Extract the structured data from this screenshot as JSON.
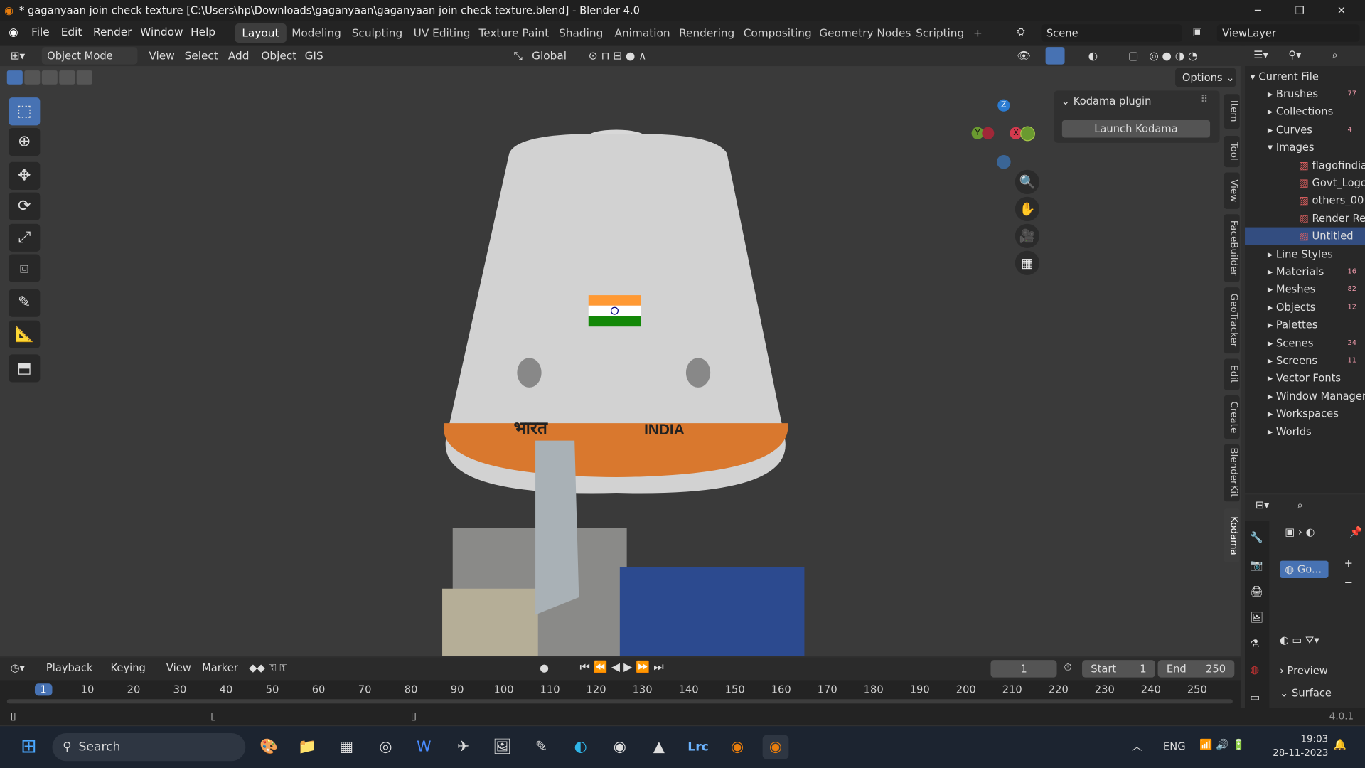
{
  "window": {
    "title": "* gaganyaan join check texture [C:\\Users\\hp\\Downloads\\gaganyaan\\gaganyaan join check texture.blend] - Blender 4.0",
    "minimize": "─",
    "maximize": "❐",
    "close": "✕"
  },
  "menubar": {
    "items": [
      "File",
      "Edit",
      "Render",
      "Window",
      "Help"
    ],
    "workspaces": [
      "Layout",
      "Modeling",
      "Sculpting",
      "UV Editing",
      "Texture Paint",
      "Shading",
      "Animation",
      "Rendering",
      "Compositing",
      "Geometry Nodes",
      "Scripting"
    ],
    "add_workspace": "+",
    "scene": "Scene",
    "view_layer": "ViewLayer"
  },
  "viewport_header": {
    "mode": "Object Mode",
    "menus": [
      "View",
      "Select",
      "Add",
      "Object",
      "GIS"
    ],
    "orientation": "Global",
    "options": "Options"
  },
  "viewport": {
    "plugin_panel_title": "Kodama plugin",
    "launch_button": "Launch Kodama",
    "side_tabs": [
      "Item",
      "Tool",
      "View",
      "FaceBuilder",
      "GeoTracker",
      "Edit",
      "Create",
      "BlenderKit",
      "Kodama"
    ],
    "gizmo": {
      "z": "Z",
      "x": "X",
      "y": "Y"
    },
    "capsule_text_hindi": "भारत",
    "capsule_text_english": "INDIA"
  },
  "outliner": {
    "root": "Current File",
    "items": [
      {
        "label": "Brushes",
        "badge": "77",
        "expanded": false
      },
      {
        "label": "Collections",
        "badge": "",
        "expanded": false
      },
      {
        "label": "Curves",
        "badge": "4",
        "expanded": false
      },
      {
        "label": "Images",
        "badge": "",
        "expanded": true
      },
      {
        "label": "flagofindia",
        "child": true
      },
      {
        "label": "Govt_Logo",
        "child": true
      },
      {
        "label": "others_00",
        "child": true
      },
      {
        "label": "Render Result",
        "child": true
      },
      {
        "label": "Untitled",
        "child": true,
        "selected": true
      },
      {
        "label": "Line Styles",
        "expanded": false
      },
      {
        "label": "Materials",
        "badge": "16",
        "expanded": false
      },
      {
        "label": "Meshes",
        "badge": "82",
        "expanded": false
      },
      {
        "label": "Objects",
        "badge": "12",
        "expanded": false
      },
      {
        "label": "Palettes",
        "expanded": false
      },
      {
        "label": "Scenes",
        "badge": "24",
        "expanded": false
      },
      {
        "label": "Screens",
        "badge": "11",
        "expanded": false
      },
      {
        "label": "Vector Fonts",
        "expanded": false
      },
      {
        "label": "Window Managers",
        "expanded": false
      },
      {
        "label": "Workspaces",
        "expanded": false
      },
      {
        "label": "Worlds",
        "expanded": false
      }
    ]
  },
  "properties": {
    "material_slot": "Go...",
    "preview": "Preview",
    "surface": "Surface"
  },
  "timeline": {
    "menus": [
      "Playback",
      "Keying",
      "View",
      "Marker"
    ],
    "current_frame": "1",
    "start_label": "Start",
    "start": "1",
    "end_label": "End",
    "end": "250",
    "ticks": [
      "1",
      "10",
      "20",
      "30",
      "40",
      "50",
      "60",
      "70",
      "80",
      "90",
      "100",
      "110",
      "120",
      "130",
      "140",
      "150",
      "160",
      "170",
      "180",
      "190",
      "200",
      "210",
      "220",
      "230",
      "240",
      "250"
    ]
  },
  "statusbar": {
    "version": "4.0.1"
  },
  "taskbar": {
    "search": "Search",
    "language": "ENG",
    "time": "19:03",
    "date": "28-11-2023"
  },
  "colors": {
    "accent": "#4772b3",
    "header": "#303030",
    "viewport": "#3a3a3a",
    "orange": "#d9782e"
  }
}
